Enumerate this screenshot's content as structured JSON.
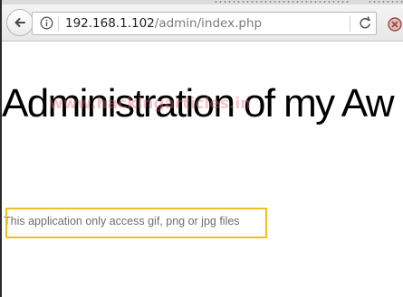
{
  "browser": {
    "url": {
      "host": "192.168.1.102",
      "path": "/admin/index.php"
    },
    "icons": {
      "back": "back-arrow-icon",
      "info": "info-icon",
      "reload": "reload-icon",
      "toolbar_right": "toolbar-badge-icon"
    }
  },
  "page": {
    "heading": "Administration of my Aw",
    "watermark": "www.hackingarticles.in",
    "notice": "This application only access gif, png or jpg files"
  },
  "colors": {
    "highlight": "#f0c020",
    "watermark": "#e4647d"
  }
}
